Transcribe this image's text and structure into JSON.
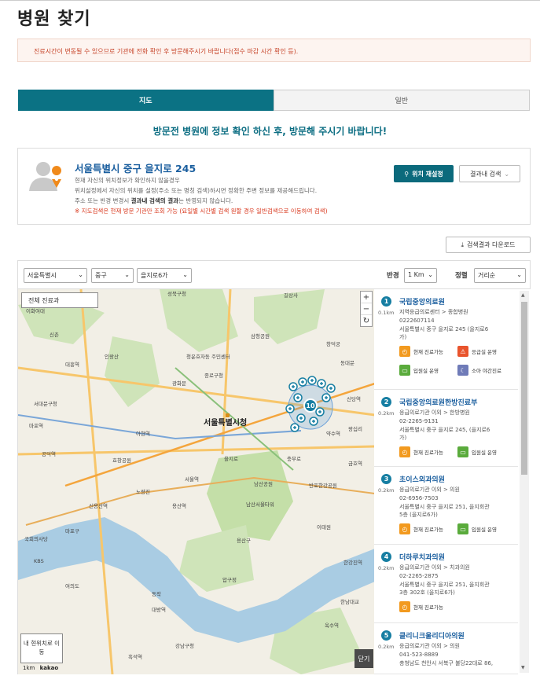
{
  "title": "병원 찾기",
  "notice": "진료시간이 변동될 수 있으므로 기관에 전화 확인 후 방문해주시기 바랍니다(접수 마감 시간 확인 등).",
  "tabs": [
    {
      "label": "지도",
      "active": true
    },
    {
      "label": "일반",
      "active": false
    }
  ],
  "guide": "방문전 병원에 정보 확인 하신 후, 방문해 주시기 바랍니다!",
  "location": {
    "address": "서울특별시 중구 을지로 245",
    "desc1": "현재 자신의 위치정보가 확인하지 않을경우",
    "desc2": "위치설정에서 자신의 위치를 설정(주소 또는 명칭 검색)하시면 정확한 주변 정보를 제공해드립니다.",
    "desc3_a": "주소 또는 반경 변경시 ",
    "desc3_b": "결과내 검색의 결과",
    "desc3_c": "는 반영되지 않습니다.",
    "warn": "※ 지도검색은 현재 방문 기관만 조회 가능 (요일별 시간별 검색 원할 경우 일반검색으로 이동하여 검색)",
    "reset_label": "위치 재설정",
    "within_label": "결과내 검색"
  },
  "download_label": "검색결과 다운로드",
  "filters": {
    "city": "서울특별시",
    "district": "중구",
    "dong": "을지로6가",
    "radius_label": "반경",
    "radius": "1 Km",
    "sort_label": "정렬",
    "sort": "거리순"
  },
  "map": {
    "dept_label": "전체 진료과",
    "center_label": "서울특별시청",
    "cluster_count": "10",
    "my_location_label": "내 현위치로 이동",
    "scale_label": "1km",
    "provider": "kakao",
    "close_label": "닫기",
    "places": [
      "길상사",
      "성북구청",
      "삼청공원",
      "창덕궁",
      "청운효자동 주민센터",
      "종로구청",
      "광화문",
      "인왕산",
      "서대문구청",
      "남산공원",
      "용산구",
      "이태원",
      "한남대교",
      "한강진역",
      "용산역",
      "반포한강공원",
      "마포구",
      "KBS",
      "국회의사당",
      "여의도",
      "대방역",
      "남산서울타워",
      "서울역",
      "을지로",
      "충무로",
      "약수역",
      "신당역",
      "동대문",
      "왕십리",
      "금호역",
      "옥수역",
      "압구정",
      "강남구청",
      "흑석역",
      "동작",
      "노량진",
      "신용산역",
      "효창공원",
      "공덕역",
      "마포역",
      "대흥역",
      "신촌",
      "연세대",
      "이화여대",
      "아현역"
    ]
  },
  "results": [
    {
      "num": "1",
      "dist": "0.1km",
      "name": "국립중앙의료원",
      "type": "지역응급의료센터 > 종합병원",
      "phone": "0222607114",
      "addr1": "서울특별시 중구 을지로 245 (을지로6",
      "addr2": "가)",
      "chips": [
        [
          "현재 진료가능",
          "orange"
        ],
        [
          "응급실 운영",
          "red"
        ],
        [
          "입원실 운영",
          "green"
        ],
        [
          "소아 야간진료",
          "blue"
        ]
      ]
    },
    {
      "num": "2",
      "dist": "0.2km",
      "name": "국립중앙의료원한방진료부",
      "type": "응급의료기관 이외 > 한방병원",
      "phone": "02-2265-9131",
      "addr1": "서울특별시 중구 을지로 245, (을지로6",
      "addr2": "가)",
      "chips": [
        [
          "현재 진료가능",
          "orange"
        ],
        [
          "입원실 운영",
          "green"
        ]
      ]
    },
    {
      "num": "3",
      "dist": "0.2km",
      "name": "초이스외과의원",
      "type": "응급의료기관 이외 > 의원",
      "phone": "02-6956-7503",
      "addr1": "서울특별시 중구 을지로 251, 을지회관",
      "addr2": "5층 (을지로6가)",
      "chips": [
        [
          "현재 진료가능",
          "orange"
        ],
        [
          "입원실 운영",
          "green"
        ]
      ]
    },
    {
      "num": "4",
      "dist": "0.2km",
      "name": "더하루치과의원",
      "type": "응급의료기관 이외 > 치과의원",
      "phone": "02-2265-2875",
      "addr1": "서울특별시 중구 을지로 251, 을지회관",
      "addr2": "3층 302호 (을지로6가)",
      "chips": [
        [
          "현재 진료가능",
          "orange"
        ]
      ]
    },
    {
      "num": "5",
      "dist": "0.2km",
      "name": "클리니크울리디아의원",
      "type": "응급의료기관 이외 > 의원",
      "phone": "041-523-8889",
      "addr1": "충청남도 천안시 서북구 불당22대로 86,",
      "addr2": "",
      "chips": []
    }
  ]
}
